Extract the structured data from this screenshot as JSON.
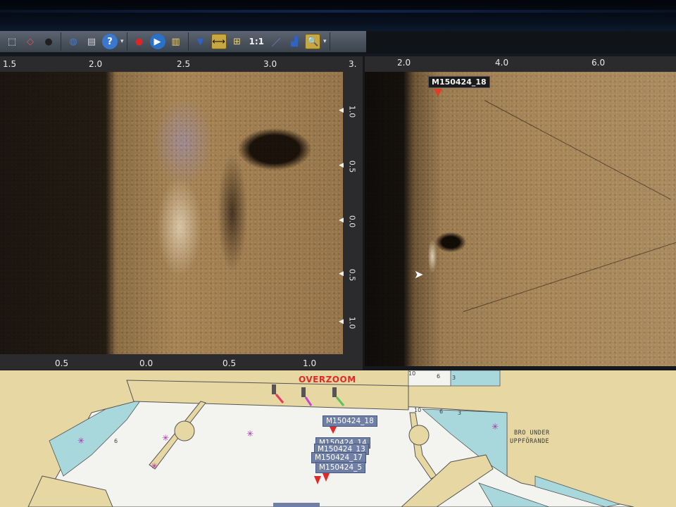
{
  "toolbar": {
    "buttons": [
      {
        "name": "zoom-region-button",
        "glyph": "⬚"
      },
      {
        "name": "erase-button",
        "glyph": "◇"
      },
      {
        "name": "track-button",
        "glyph": "●"
      },
      {
        "name": "globe-button",
        "glyph": "◍"
      },
      {
        "name": "print-button",
        "glyph": "▤"
      },
      {
        "name": "help-button",
        "glyph": "?"
      },
      {
        "name": "record-button",
        "glyph": "●"
      },
      {
        "name": "play-button",
        "glyph": "▶"
      },
      {
        "name": "clipboard-button",
        "glyph": "▥"
      },
      {
        "name": "dropdown-triangle-button",
        "glyph": "▼"
      },
      {
        "name": "fit-width-button",
        "glyph": "⟷"
      },
      {
        "name": "fit-all-button",
        "glyph": "⊞"
      },
      {
        "name": "measure-button",
        "glyph": "／"
      },
      {
        "name": "chart-levels-button",
        "glyph": "▟"
      },
      {
        "name": "magnifier-button",
        "glyph": "🔍"
      }
    ],
    "scale_label": "1:1"
  },
  "sonar_left": {
    "top_ticks": [
      "1.5",
      "2.0",
      "2.5",
      "3.0",
      "3."
    ],
    "bottom_ticks": [
      "0.5",
      "0.0",
      "0.5",
      "1.0"
    ],
    "right_ticks": [
      "1.0",
      "0.5",
      "0.0",
      "0.5",
      "1.0"
    ]
  },
  "sonar_right": {
    "top_ticks": [
      "2.0",
      "4.0",
      "6.0"
    ],
    "marker_label": "M150424_18"
  },
  "chart": {
    "overzoom_label": "OVERZOOM",
    "bridge_text_line1": "BRO UNDER",
    "bridge_text_line2": "UPPFÖRANDE",
    "depths": [
      "10",
      "6",
      "3",
      "10",
      "6",
      "3",
      "6"
    ],
    "waypoints": [
      "M150424_18",
      "M150424_14",
      "M150424_13",
      "M150424_17",
      "M150424_5"
    ],
    "colors": {
      "land": "#e6d7a3",
      "shallow": "#a9d8dc",
      "water": "#f3f4f0",
      "pier": "#e6d7a3"
    }
  }
}
